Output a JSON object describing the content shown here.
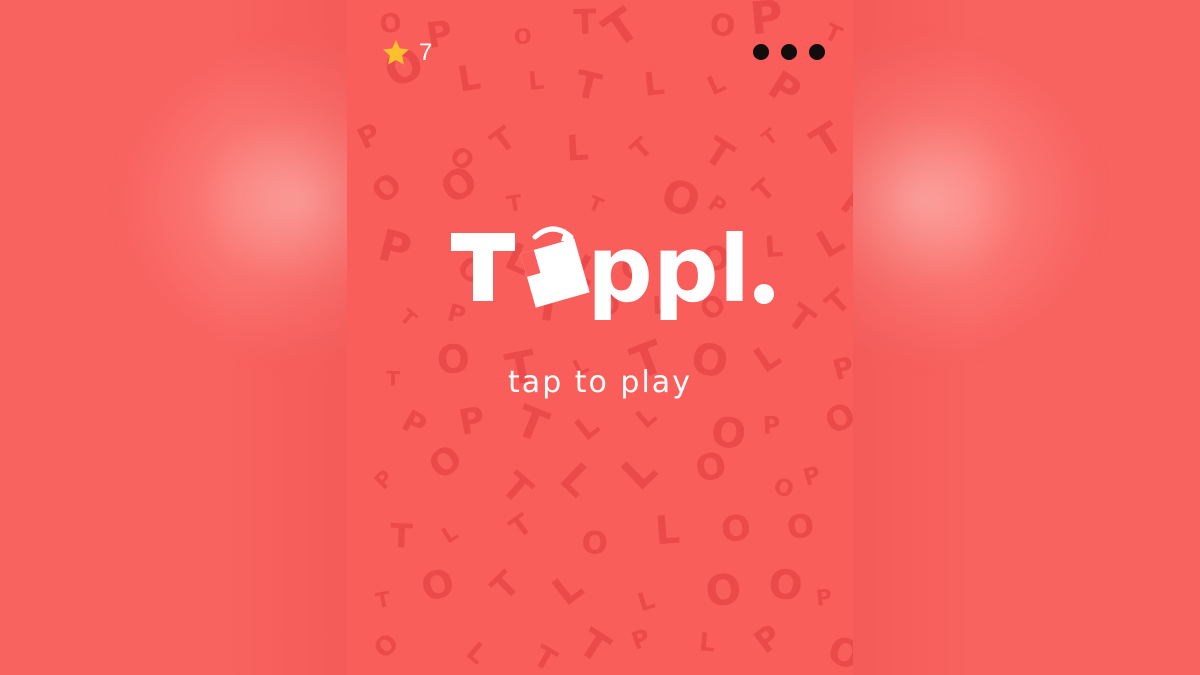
{
  "game": {
    "title": "Toppl.",
    "prompt": "tap to play"
  },
  "hud": {
    "star_count": "7",
    "star_icon": "star-icon",
    "menu_icon": "more-dots-icon"
  },
  "colors": {
    "background": "#f8625f",
    "screen": "#fa5e5a",
    "pattern_letters": "#ea4a4a",
    "text": "#ffffff",
    "star": "#fbc02d",
    "menu_dots": "#120c0c"
  },
  "background_pattern": {
    "letters": [
      "T",
      "O",
      "P",
      "L"
    ]
  }
}
